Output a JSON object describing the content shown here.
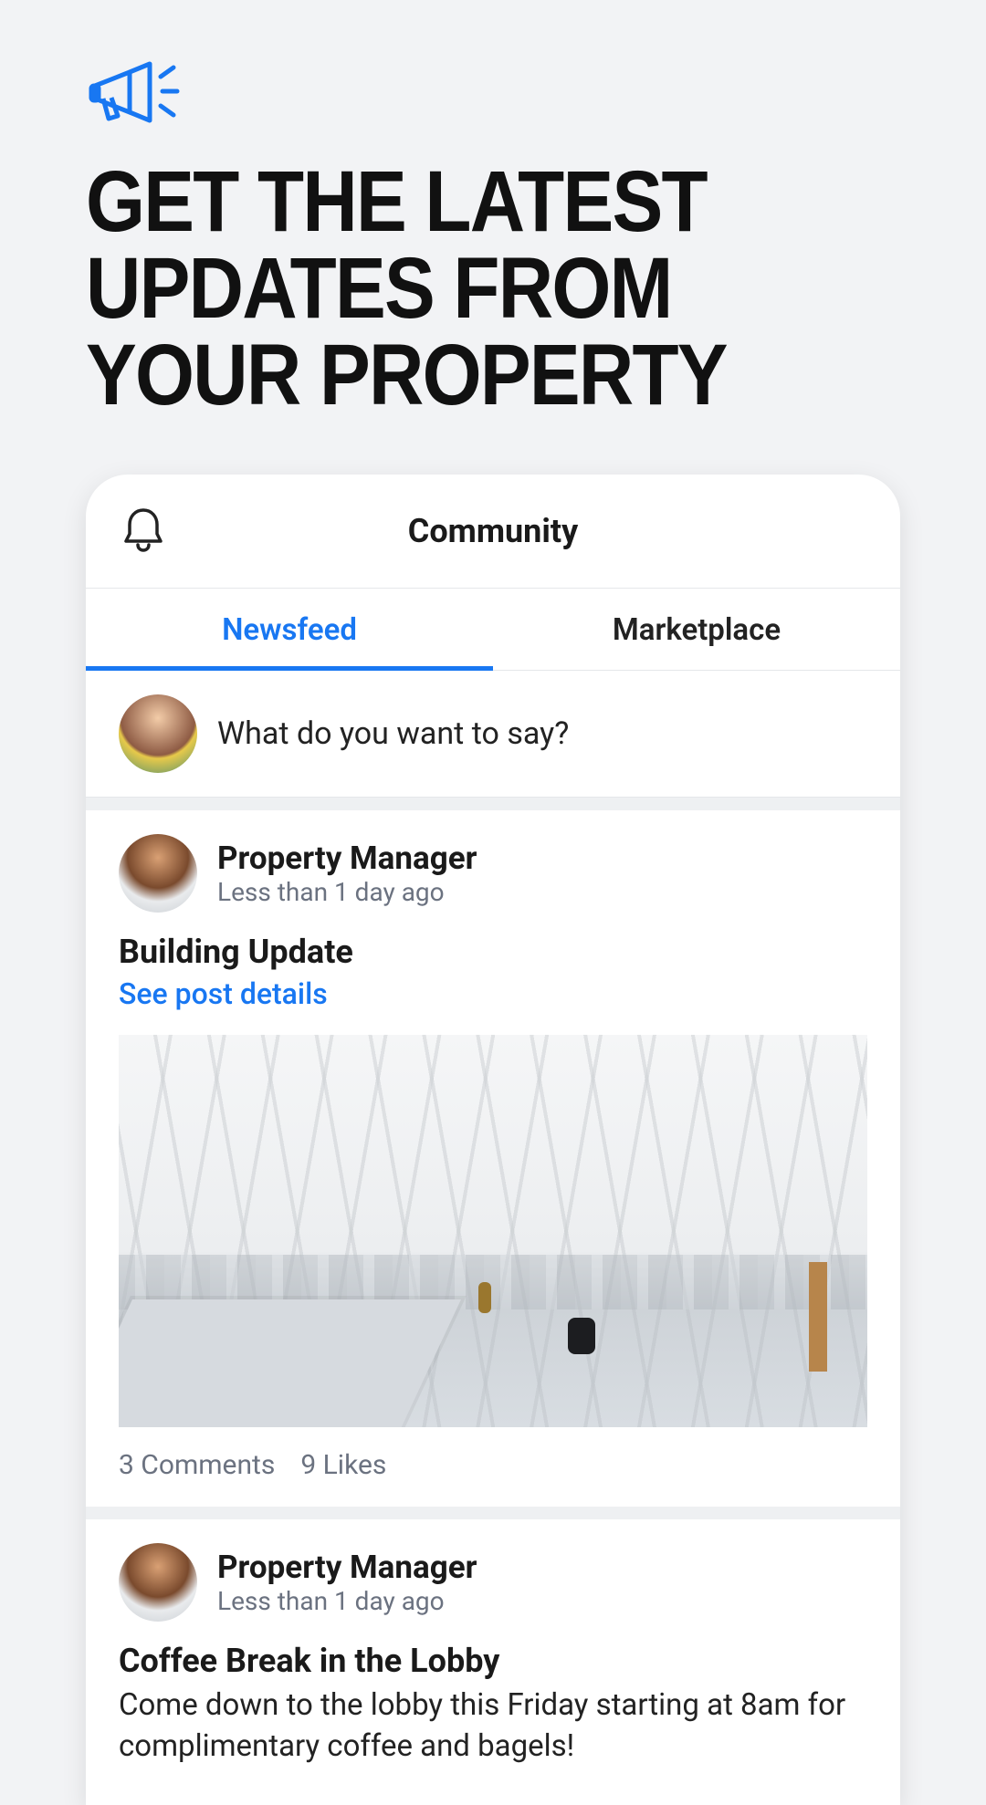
{
  "hero": {
    "headline": "GET THE LATEST UPDATES FROM YOUR PROPERTY"
  },
  "header": {
    "title": "Community"
  },
  "tabs": {
    "newsfeed": "Newsfeed",
    "marketplace": "Marketplace"
  },
  "composer": {
    "placeholder": "What do you want to say?"
  },
  "posts": [
    {
      "author": "Property Manager",
      "time": "Less than 1 day ago",
      "title": "Building Update",
      "link": "See post details",
      "comments": "3 Comments",
      "likes": "9 Likes"
    },
    {
      "author": "Property Manager",
      "time": "Less than 1 day ago",
      "title": "Coffee Break in the Lobby",
      "body": "Come down to the lobby this Friday starting at 8am for complimentary coffee and bagels!"
    }
  ]
}
